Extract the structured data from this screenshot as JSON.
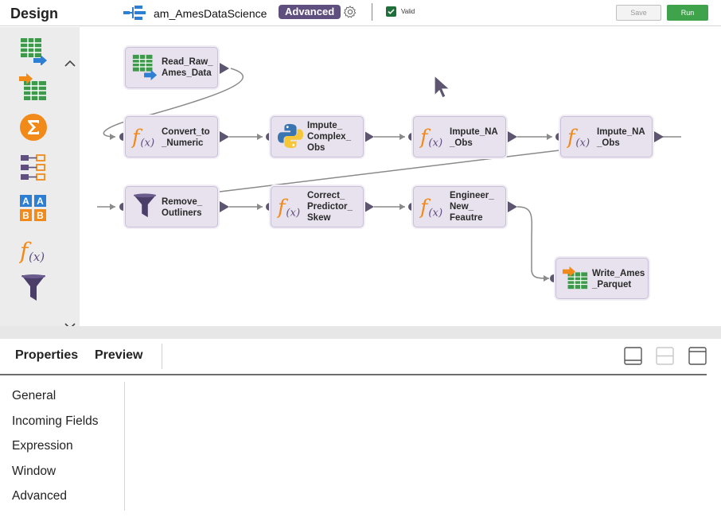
{
  "header": {
    "title": "Design",
    "mapping_name": "am_AmesDataScience",
    "mode_badge": "Advanced",
    "valid_label": "Valid",
    "save_label": "Save",
    "run_label": "Run"
  },
  "canvas": {
    "nodes": [
      {
        "label": "Read_Raw_\nAmes_Data",
        "icon": "source-table-icon"
      },
      {
        "label": "Convert_to\n_Numeric",
        "icon": "expression-icon"
      },
      {
        "label": "Impute_\nComplex_\nObs",
        "icon": "python-icon"
      },
      {
        "label": "Impute_NA\n_Obs",
        "icon": "expression-icon"
      },
      {
        "label": "Impute_NA\n_Obs",
        "icon": "expression-icon"
      },
      {
        "label": "Remove_\nOutliners",
        "icon": "filter-icon"
      },
      {
        "label": "Correct_\nPredictor_\nSkew",
        "icon": "expression-icon"
      },
      {
        "label": "Engineer_\nNew_\nFeautre",
        "icon": "expression-icon"
      },
      {
        "label": "Write_Ames\n_Parquet",
        "icon": "target-table-icon"
      }
    ]
  },
  "palette": {
    "icons": [
      "source-table-icon",
      "target-table-icon",
      "aggregator-icon",
      "hierarchy-icon",
      "ab-sorter-icon",
      "expression-icon",
      "filter-icon"
    ]
  },
  "panel": {
    "tabs": [
      "Properties",
      "Preview"
    ],
    "sections": [
      "General",
      "Incoming Fields",
      "Expression",
      "Window",
      "Advanced"
    ]
  },
  "colors": {
    "accent_purple": "#5e4f7e",
    "node_fill": "#e8e2ee",
    "run_green": "#3ea34a",
    "expression_orange": "#f28a1a",
    "table_green": "#3d9a4a",
    "arrow_blue": "#2d7fd3"
  }
}
